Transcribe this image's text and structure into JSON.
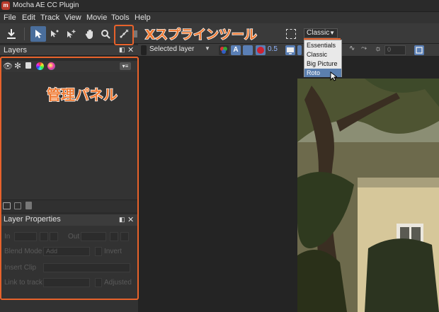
{
  "window": {
    "title": "Mocha AE CC Plugin"
  },
  "menu": [
    "File",
    "Edit",
    "Track",
    "View",
    "Movie",
    "Tools",
    "Help"
  ],
  "toolbar2": {
    "layer_select": "Selected layer",
    "opacity_value": "0.5",
    "frame_value": "0"
  },
  "layers_panel": {
    "title": "Layers"
  },
  "layer_properties": {
    "title": "Layer Properties",
    "in_label": "In",
    "out_label": "Out",
    "blend_mode_label": "Blend Mode",
    "blend_mode_value": "Add",
    "invert_label": "Invert",
    "insert_clip_label": "Insert Clip",
    "link_to_track_label": "Link to track",
    "adjusted_label": "Adjusted"
  },
  "view_dropdown": {
    "selected": "Classic",
    "options": [
      "Essentials",
      "Classic",
      "Big Picture",
      "Roto"
    ],
    "highlighted": "Roto"
  },
  "annotations": {
    "xspline_tool": "Xスプラインツール",
    "management_panel": "管理パネル"
  },
  "colors": {
    "accent": "#e8622b",
    "selection": "#4a6e9c",
    "menu_highlight": "#5b7fae"
  }
}
